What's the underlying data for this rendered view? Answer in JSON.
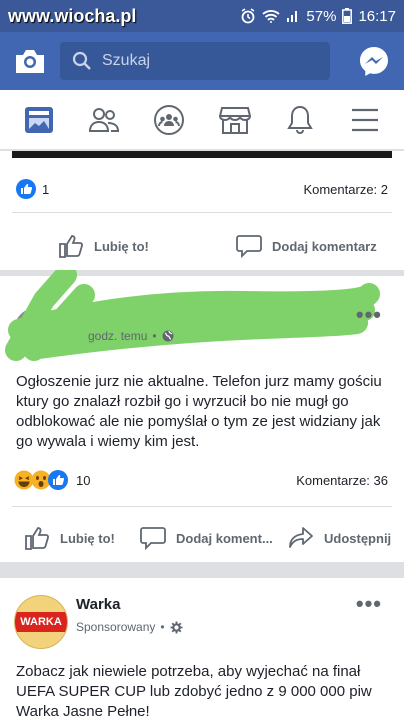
{
  "status": {
    "watermark": "www.wiocha.pl",
    "battery": "57%",
    "time": "16:17"
  },
  "search": {
    "placeholder": "Szukaj"
  },
  "nav": [
    {
      "name": "news-feed"
    },
    {
      "name": "friends"
    },
    {
      "name": "groups"
    },
    {
      "name": "marketplace"
    },
    {
      "name": "notifications"
    },
    {
      "name": "menu"
    }
  ],
  "post1": {
    "reaction_count": "1",
    "comments": "Komentarze: 2",
    "like_label": "Lubię to!",
    "comment_label": "Dodaj komentarz"
  },
  "post2": {
    "time": "godz. temu",
    "body": "Ogłoszenie jurz nie aktualne. Telefon jurz mamy gościu ktury go znalazł rozbił go i wyrzucił bo nie mugł go odblokować ale nie pomyślał o tym ze jest widziany jak go wywala i wiemy kim jest.",
    "reaction_count": "10",
    "comments": "Komentarze: 36",
    "like_label": "Lubię to!",
    "comment_label": "Dodaj koment...",
    "share_label": "Udostępnij"
  },
  "post3": {
    "author": "Warka",
    "sponsored": "Sponsorowany",
    "logo_text": "WARKA",
    "body": "Zobacz jak niewiele potrzeba, aby wyjechać na finał UEFA SUPER CUP lub zdobyć jedno z 9 000 000 piw Warka Jasne Pełne!"
  },
  "colors": {
    "header": "#4267b2",
    "statusbar": "#3b5998",
    "like_blue": "#1877f2",
    "scribble": "#7fd169"
  }
}
